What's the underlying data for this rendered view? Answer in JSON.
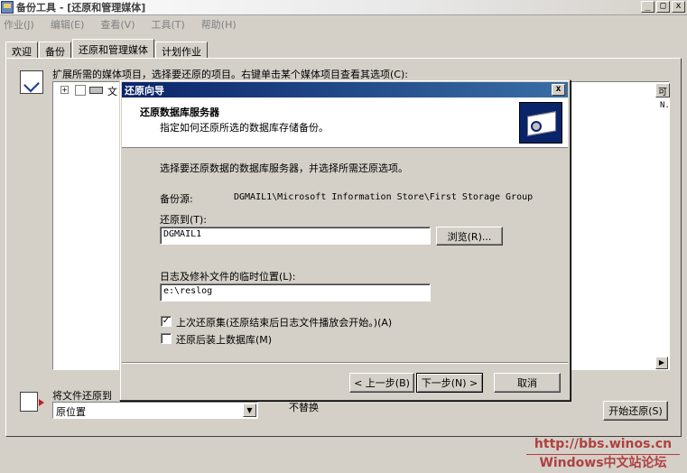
{
  "window": {
    "title": "备份工具 - [还原和管理媒体]"
  },
  "menu": [
    "作业(J)",
    "编辑(E)",
    "查看(V)",
    "工具(T)",
    "帮助(H)"
  ],
  "tabs": [
    "欢迎",
    "备份",
    "还原和管理媒体",
    "计划作业"
  ],
  "main": {
    "instruction": "扩展所需的媒体项目，选择要还原的项目。右键单击某个媒体项目查看其选项(C):",
    "tree_item": "文",
    "column_header": "可",
    "column_value": "N.",
    "restore_to_label": "将文件还原到",
    "restore_to_value": "原位置",
    "replace_value": "不替换",
    "start_restore_button": "开始还原(S)"
  },
  "dialog": {
    "title": "还原向导",
    "header_title": "还原数据库服务器",
    "header_subtitle": "指定如何还原所选的数据库存储备份。",
    "instruction": "选择要还原数据的数据库服务器，并选择所需还原选项。",
    "backup_source_label": "备份源:",
    "backup_source_value": "DGMAIL1\\Microsoft Information Store\\First Storage Group",
    "restore_to_label": "还原到(T):",
    "restore_to_value": "DGMAIL1",
    "browse_button": "浏览(R)...",
    "temp_location_label": "日志及修补文件的临时位置(L):",
    "temp_location_value": "e:\\reslog",
    "last_restore_set_label": "上次还原集(还原结束后日志文件播放会开始。)(A)",
    "last_restore_set_checked": true,
    "mount_db_label": "还原后装上数据库(M)",
    "mount_db_checked": false,
    "back_button": "< 上一步(B)",
    "next_button": "下一步(N) >",
    "cancel_button": "取消"
  },
  "watermark": {
    "url": "http://bbs.winos.cn",
    "site": "Windows中文站论坛"
  }
}
